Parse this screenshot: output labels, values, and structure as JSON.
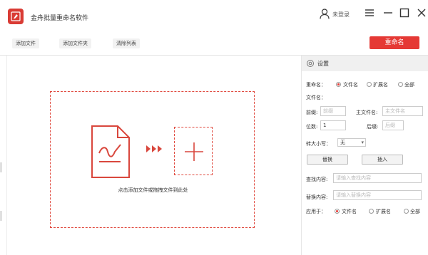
{
  "app": {
    "title": "金舟批量重命名软件",
    "user_label": "未登录"
  },
  "toolbar": {
    "add_file": "添加文件",
    "add_folder": "添加文件夹",
    "clear_list": "清除列表",
    "rename": "重命名"
  },
  "drop_zone": {
    "hint": "点击添加文件或拖拽文件到此处"
  },
  "settings": {
    "title": "设置",
    "rename_label": "重命名：",
    "rename_options": [
      "文件名",
      "扩展名",
      "全部"
    ],
    "rename_selected": "文件名",
    "filename_label": "文件名：",
    "prefix_label": "前缀:",
    "prefix_placeholder": "前缀",
    "main_name_label": "主文件名:",
    "main_name_placeholder": "主文件名",
    "digits_label": "位数:",
    "digits_value": "1",
    "suffix_label": "后缀:",
    "suffix_placeholder": "后缀",
    "case_label": "转大小写：",
    "case_value": "无",
    "replace_button": "替换",
    "insert_button": "插入",
    "find_label": "查找内容:",
    "find_placeholder": "请输入查找内容",
    "replace_label": "替换内容:",
    "replace_placeholder": "请输入替换内容",
    "apply_label": "应用于：",
    "apply_options": [
      "文件名",
      "扩展名",
      "全部"
    ],
    "apply_selected": "文件名"
  },
  "colors": {
    "accent": "#e53935",
    "dashed": "#e04a3f"
  }
}
